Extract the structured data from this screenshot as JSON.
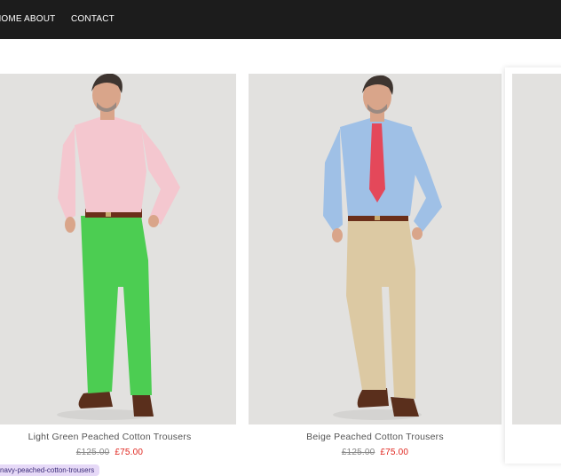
{
  "nav": {
    "items": [
      {
        "label": "HOME"
      },
      {
        "label": "ABOUT"
      },
      {
        "label": "CONTACT"
      }
    ]
  },
  "products": [
    {
      "title": "Light Green Peached Cotton Trousers",
      "old_price": "£125.00",
      "sale_price": "£75.00",
      "shirt_color": "#f4c7cf",
      "trouser_color": "#4ccd52",
      "tie": false
    },
    {
      "title": "Beige Peached Cotton Trousers",
      "old_price": "£125.00",
      "sale_price": "£75.00",
      "shirt_color": "#9fc0e6",
      "trouser_color": "#dcc9a3",
      "tie": true,
      "tie_color": "#e4485a"
    }
  ],
  "status_url": "navy-peached-cotton-trousers",
  "colors": {
    "topbar": "#1c1c1c",
    "sale": "#e0261f",
    "tooltip_bg": "#e6d9f7"
  }
}
